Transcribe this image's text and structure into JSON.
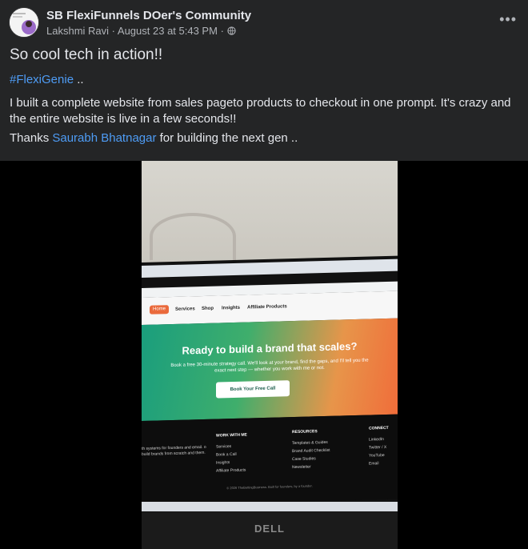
{
  "post": {
    "group_name": "SB FlexiFunnels DOer's Community",
    "author": "Lakshmi Ravi",
    "timestamp": "August 23 at 5:43 PM",
    "separator": "·",
    "privacy_icon": "globe-icon",
    "more_label": "•••",
    "title": "So cool tech in action!!",
    "hashtag": "#FlexiGenie",
    "hashtag_suffix": " ..",
    "body": "I built a complete website from sales pageto products to checkout in one prompt. It's crazy and the entire website is live in a few seconds!!",
    "thanks_prefix": "Thanks ",
    "mention": "Saurabh Bhatnagar",
    "thanks_suffix": " for building the next gen .."
  },
  "photo": {
    "site_nav": [
      "Home",
      "Services",
      "Shop",
      "Insights",
      "Affiliate Products"
    ],
    "hero_title": "Ready to build a brand that scales?",
    "hero_subtitle": "Book a free 30-minute strategy call. We'll look at your brand, find the gaps, and I'll tell you the exact next step — whether you work with me or not.",
    "cta": "Book Your Free Call",
    "footer": {
      "work_with_me": {
        "title": "WORK WITH ME",
        "items": [
          "Services",
          "Book a Call",
          "Insights",
          "Affiliate Products"
        ]
      },
      "resources": {
        "title": "RESOURCES",
        "items": [
          "Templates & Guides",
          "Brand Audit Checklist",
          "Case Studies",
          "Newsletter"
        ]
      },
      "connect": {
        "title": "CONNECT",
        "items": [
          "LinkedIn",
          "Twitter / X",
          "YouTube",
          "Email"
        ]
      },
      "blurb": "th systems for founders and email. o build brands from scratch and them.",
      "copyright": "© 2026 TheBettingBusiness. Built for founders, by a founder."
    },
    "laptop_brand": "DELL"
  }
}
